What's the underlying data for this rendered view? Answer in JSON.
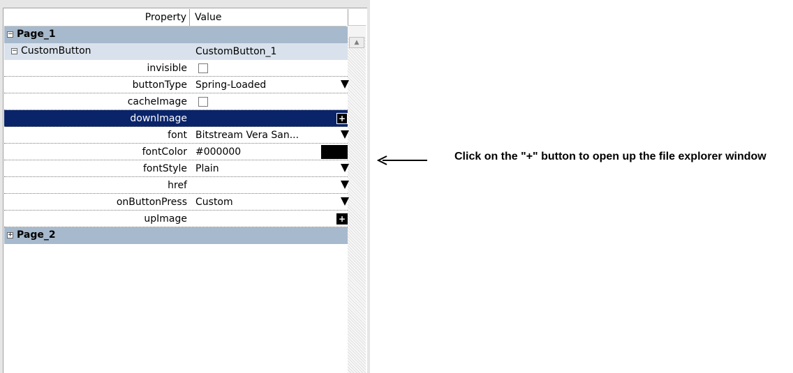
{
  "header": {
    "property": "Property",
    "value": "Value"
  },
  "groups": [
    {
      "label": "Page_1",
      "expander": "−"
    },
    {
      "label": "Page_2",
      "expander": "+"
    }
  ],
  "component": {
    "name": "CustomButton",
    "value": "CustomButton_1",
    "expander": "−"
  },
  "properties": [
    {
      "name": "invisible",
      "value": "",
      "editor": "checkbox"
    },
    {
      "name": "buttonType",
      "value": "Spring-Loaded",
      "editor": "dropdown"
    },
    {
      "name": "cacheImage",
      "value": "",
      "editor": "checkbox"
    },
    {
      "name": "downImage",
      "value": "",
      "editor": "plus",
      "selected": true
    },
    {
      "name": "font",
      "value": "Bitstream Vera San...",
      "editor": "dropdown"
    },
    {
      "name": "fontColor",
      "value": "#000000",
      "editor": "color"
    },
    {
      "name": "fontStyle",
      "value": "Plain",
      "editor": "dropdown"
    },
    {
      "name": "href",
      "value": "",
      "editor": "dropdown"
    },
    {
      "name": "onButtonPress",
      "value": "Custom",
      "editor": "dropdown"
    },
    {
      "name": "upImage",
      "value": "",
      "editor": "plus"
    }
  ],
  "plus_label": "+",
  "annotation": {
    "text": "Click on  the  \"+\" button to open up the file explorer window"
  },
  "colors": {
    "group_bg": "#a7b9cc",
    "sub_bg": "#d9e2ec",
    "selected_bg": "#0a246a",
    "swatch": "#000000"
  }
}
